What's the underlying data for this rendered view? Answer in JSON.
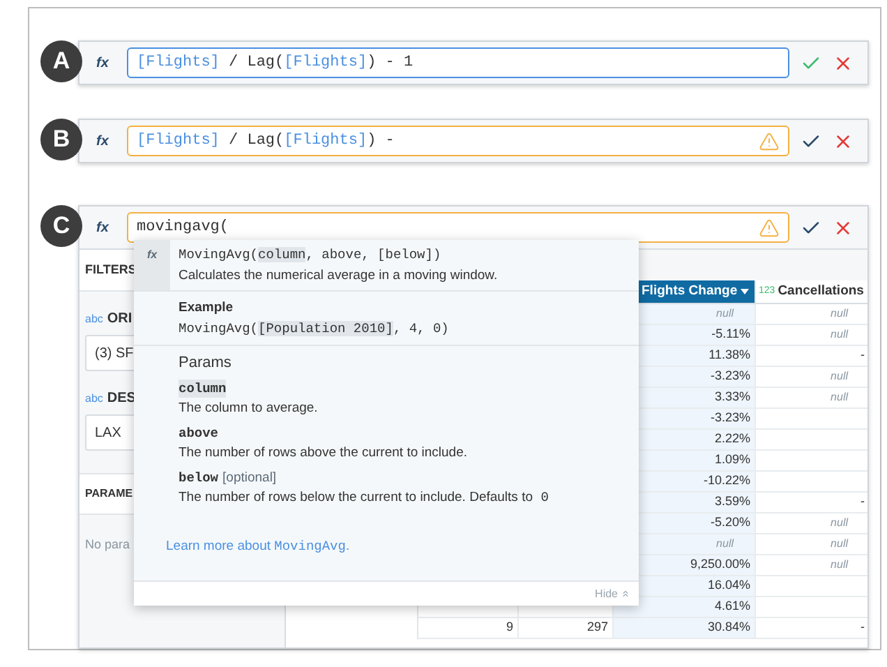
{
  "panels": [
    {
      "label": "A",
      "fx": "fx",
      "warning": false,
      "formula": [
        {
          "kind": "column",
          "text": "[Flights]"
        },
        {
          "kind": "text",
          "text": " / Lag("
        },
        {
          "kind": "column",
          "text": "[Flights]"
        },
        {
          "kind": "text",
          "text": ") - 1"
        }
      ]
    },
    {
      "label": "B",
      "fx": "fx",
      "warning": true,
      "formula": [
        {
          "kind": "column",
          "text": "[Flights]"
        },
        {
          "kind": "text",
          "text": " / Lag("
        },
        {
          "kind": "column",
          "text": "[Flights]"
        },
        {
          "kind": "text",
          "text": ") -"
        }
      ]
    },
    {
      "label": "C",
      "fx": "fx",
      "warning": true,
      "formula": [
        {
          "kind": "text",
          "text": "movingavg("
        }
      ],
      "sidebar": {
        "filters_heading": "FILTERS",
        "filters": [
          {
            "type_tag": "abc",
            "name": "ORI",
            "value": "(3) SF"
          },
          {
            "type_tag": "abc",
            "name": "DES",
            "value": "LAX"
          }
        ],
        "parameters_heading": "PARAME",
        "parameters_empty": "No para"
      },
      "table": {
        "columns": [
          {
            "name": "Flights Change",
            "selected": true
          },
          {
            "name": "Cancellations",
            "type_tag": "123",
            "selected": false
          }
        ],
        "rows": [
          {
            "cells": [
              {
                "kind": "null",
                "text": "null"
              },
              {
                "kind": "null",
                "text": "null"
              }
            ]
          },
          {
            "cells": [
              {
                "kind": "value",
                "text": "-5.11%"
              },
              {
                "kind": "null",
                "text": "null"
              }
            ]
          },
          {
            "cells": [
              {
                "kind": "value",
                "text": "11.38%"
              },
              {
                "kind": "value",
                "text": "-"
              }
            ]
          },
          {
            "cells": [
              {
                "kind": "value",
                "text": "-3.23%"
              },
              {
                "kind": "null",
                "text": "null"
              }
            ]
          },
          {
            "cells": [
              {
                "kind": "value",
                "text": "3.33%"
              },
              {
                "kind": "null",
                "text": "null"
              }
            ]
          },
          {
            "cells": [
              {
                "kind": "value",
                "text": "-3.23%"
              },
              null
            ]
          },
          {
            "cells": [
              {
                "kind": "value",
                "text": "2.22%"
              },
              null
            ]
          },
          {
            "cells": [
              {
                "kind": "value",
                "text": "1.09%"
              },
              null
            ]
          },
          {
            "cells": [
              {
                "kind": "value",
                "text": "-10.22%"
              },
              null
            ]
          },
          {
            "cells": [
              {
                "kind": "value",
                "text": "3.59%"
              },
              {
                "kind": "value",
                "text": "-"
              }
            ]
          },
          {
            "cells": [
              {
                "kind": "value",
                "text": "-5.20%"
              },
              {
                "kind": "null",
                "text": "null"
              }
            ]
          },
          {
            "cells": [
              {
                "kind": "null",
                "text": "null"
              },
              {
                "kind": "null",
                "text": "null"
              }
            ]
          },
          {
            "cells": [
              {
                "kind": "value",
                "text": "9,250.00%"
              },
              {
                "kind": "null",
                "text": "null"
              }
            ]
          },
          {
            "cells": [
              {
                "kind": "value",
                "text": "16.04%"
              },
              null
            ]
          },
          {
            "cells": [
              {
                "kind": "value",
                "text": "4.61%"
              },
              null
            ]
          },
          {
            "leading": [
              "9",
              "297"
            ],
            "cells": [
              {
                "kind": "value",
                "text": "30.84%"
              },
              {
                "kind": "value",
                "text": "-"
              }
            ]
          }
        ]
      },
      "popup": {
        "fx": "fx",
        "signature": [
          {
            "text": "MovingAvg(",
            "highlighted": false
          },
          {
            "text": "column",
            "highlighted": true
          },
          {
            "text": ", above, [below])",
            "highlighted": false
          }
        ],
        "summary": "Calculates the numerical average in a moving window.",
        "example_heading": "Example",
        "example": [
          {
            "text": "MovingAvg(",
            "highlighted": false
          },
          {
            "text": "[Population 2010]",
            "highlighted": true
          },
          {
            "text": ", 4, 0)",
            "highlighted": false
          }
        ],
        "params_heading": "Params",
        "params": [
          {
            "name": "column",
            "highlighted": true,
            "description": "The column to average."
          },
          {
            "name": "above",
            "highlighted": false,
            "description": "The number of rows above the current to include."
          },
          {
            "name": "below",
            "highlighted": false,
            "note": "[optional]",
            "description": "The number of rows below the current to include. Defaults to",
            "default_value": "0"
          }
        ],
        "link": {
          "text": "Learn more about ",
          "code": "MovingAvg",
          "suffix": "."
        },
        "hide": "Hide"
      }
    }
  ]
}
